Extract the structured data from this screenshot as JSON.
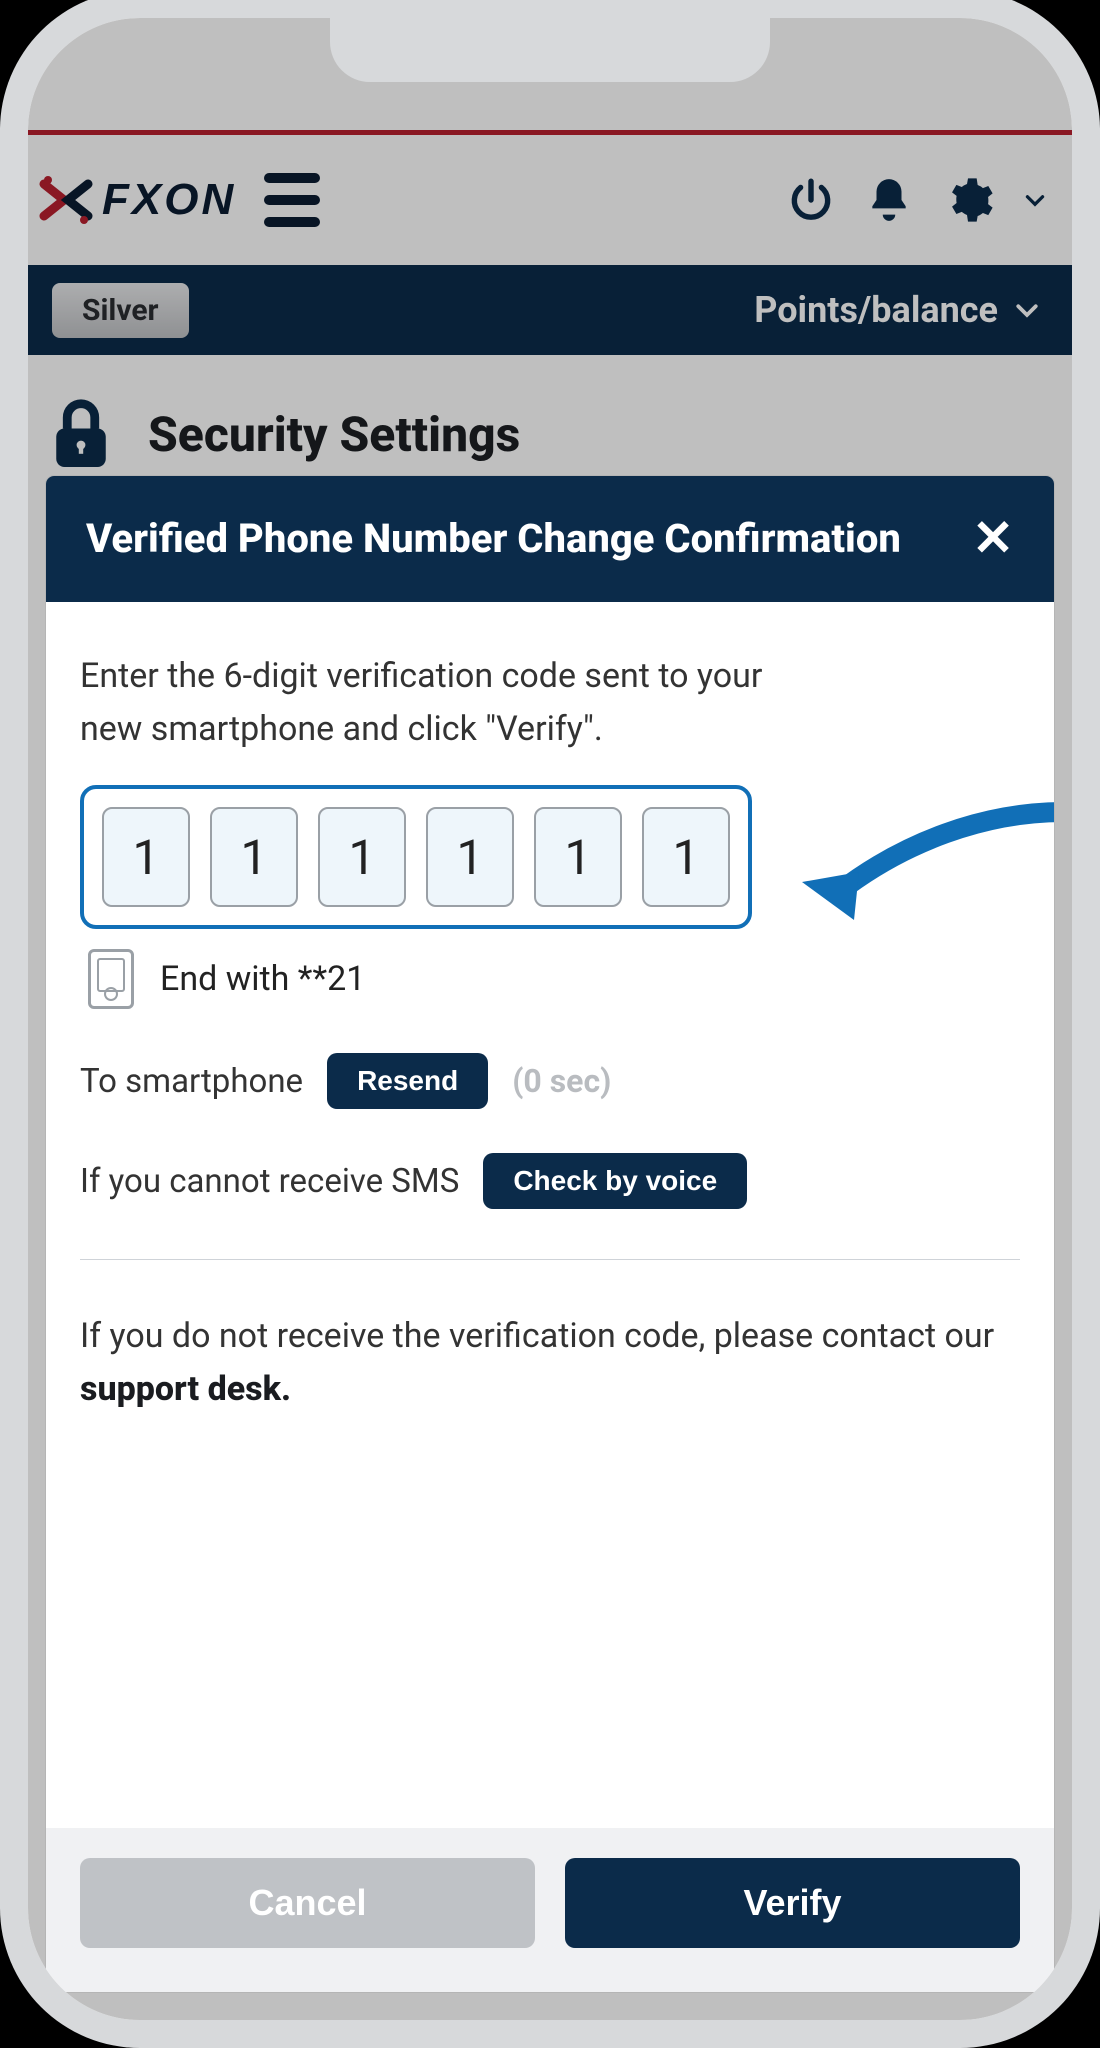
{
  "brand": {
    "name": "FXON"
  },
  "subbar": {
    "tier_label": "Silver",
    "points_label": "Points/balance"
  },
  "page": {
    "title": "Security Settings"
  },
  "modal": {
    "title": "Verified Phone Number Change Confirmation",
    "instruction": "Enter the 6-digit verification code sent to your new smartphone and click \"Verify\".",
    "code_digits": [
      "1",
      "1",
      "1",
      "1",
      "1",
      "1"
    ],
    "end_with_label": "End with **21",
    "to_smartphone_label": "To smartphone",
    "resend_label": "Resend",
    "countdown_label": "(0 sec)",
    "cannot_receive_label": "If you cannot receive SMS",
    "check_voice_label": "Check by voice",
    "support_prefix": "If you do not receive the verification code, please contact our ",
    "support_link": "support desk.",
    "cancel_label": "Cancel",
    "verify_label": "Verify"
  },
  "colors": {
    "accent_red": "#b8202f",
    "brand_navy": "#0b2b4a",
    "highlight_blue": "#116fb7"
  }
}
